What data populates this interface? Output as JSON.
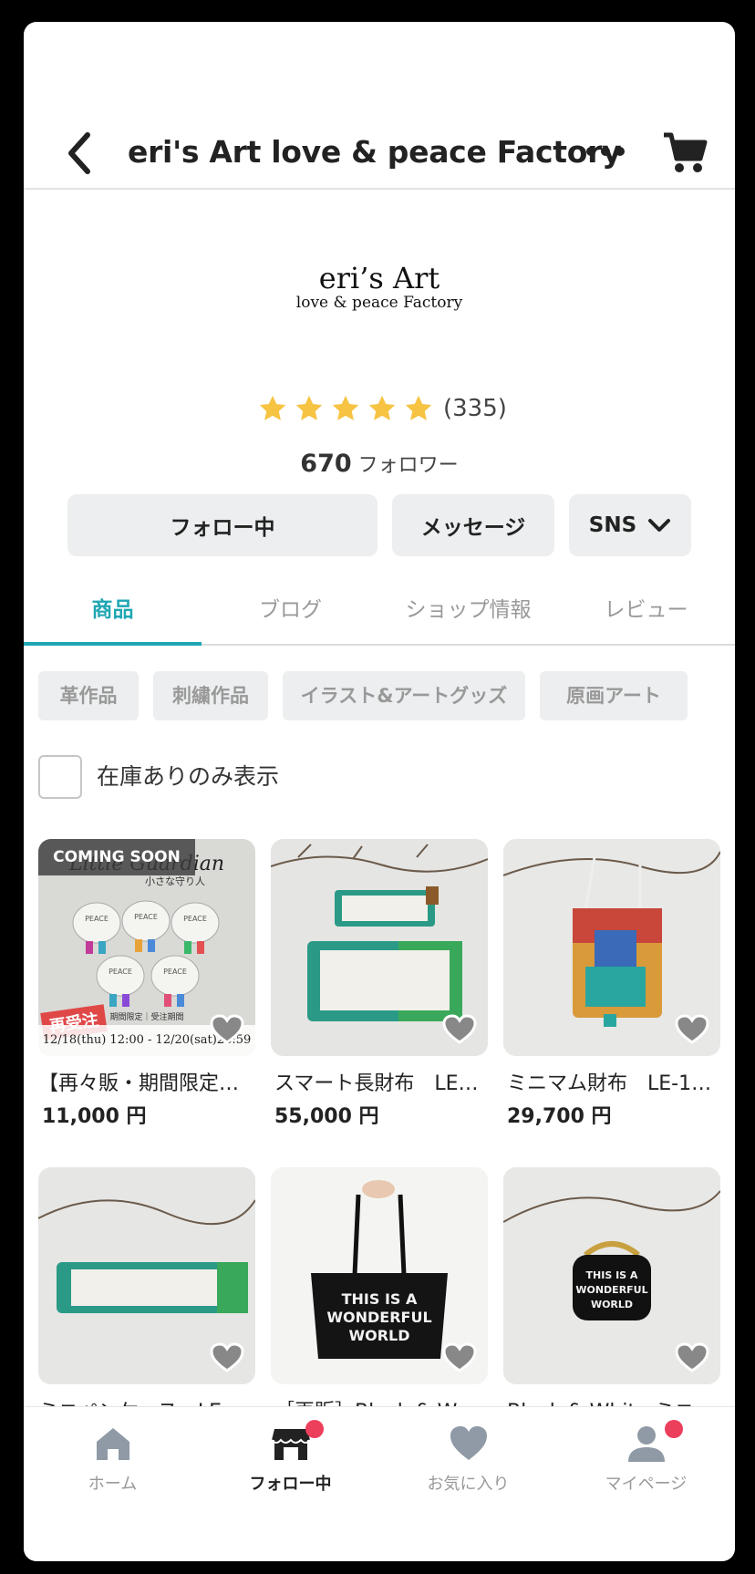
{
  "header": {
    "title": "eri's Art love & peace Factory"
  },
  "shop": {
    "logo_main": "eri’s Art",
    "logo_sub": "love & peace Factory",
    "rating_stars": 5,
    "rating_count": "(335)",
    "followers_count": "670",
    "followers_label": "フォロワー"
  },
  "actions": {
    "follow": "フォロー中",
    "message": "メッセージ",
    "sns": "SNS"
  },
  "tabs": [
    {
      "label": "商品",
      "active": true
    },
    {
      "label": "ブログ",
      "active": false
    },
    {
      "label": "ショップ情報",
      "active": false
    },
    {
      "label": "レビュー",
      "active": false
    }
  ],
  "categories": [
    "革作品",
    "刺繍作品",
    "イラスト&アートグッズ",
    "原画アート"
  ],
  "stock_filter": {
    "label": "在庫ありのみ表示",
    "checked": false
  },
  "products": [
    {
      "name": "【再々販・期間限定…",
      "price": "11,000 円",
      "badge": "COMING SOON",
      "tag": "再受注",
      "overlay_date": "12/18(thu) 12:00 - 12/20(sat)23:59",
      "overlay_note": "期間限定｜受注期間",
      "overlay_title": "Little Guardian",
      "overlay_sub": "小さな守り人"
    },
    {
      "name": "スマート長財布　LE…",
      "price": "55,000 円"
    },
    {
      "name": "ミニマム財布　LE-1…",
      "price": "29,700 円"
    },
    {
      "name": "ミニペンケース　LE…",
      "price": ""
    },
    {
      "name": "［再販］Black & W…",
      "price": ""
    },
    {
      "name": "Black & White ミニ…",
      "price": ""
    }
  ],
  "bottom_nav": [
    {
      "label": "ホーム",
      "active": false,
      "dot": false
    },
    {
      "label": "フォロー中",
      "active": true,
      "dot": true
    },
    {
      "label": "お気に入り",
      "active": false,
      "dot": false
    },
    {
      "label": "マイページ",
      "active": false,
      "dot": true
    }
  ],
  "colors": {
    "accent": "#1fa6b3",
    "star": "#f6c343",
    "notification": "#ec3f5c"
  }
}
